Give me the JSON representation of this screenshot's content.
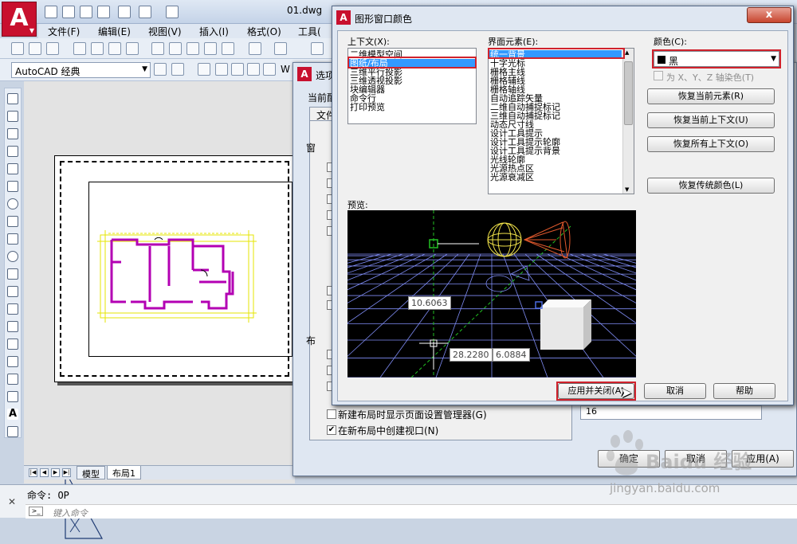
{
  "app": {
    "doc_title": "01.dwg",
    "logo_letter": "A",
    "menus": [
      "文件(F)",
      "编辑(E)",
      "视图(V)",
      "插入(I)",
      "格式(O)",
      "工具("
    ],
    "workspace": "AutoCAD 经典",
    "toolbar2_trailing": "W"
  },
  "layout_tabs": [
    "模型",
    "布局1"
  ],
  "command": {
    "history": "命令: OP",
    "placeholder": "键入命令",
    "prompt_icon": ">_"
  },
  "options_dialog": {
    "title": "选项",
    "current_profile_label": "当前配",
    "tab_label": "文件",
    "group1_label": "窗",
    "group2_label": "布",
    "checkbox1_label": "新建布局时显示页面设置管理器(G)",
    "checkbox2_label": "在新布局中创建视口(N)",
    "checkbox2_checked": true,
    "right_field": "16",
    "buttons": [
      "确定",
      "取消",
      "应用(A)"
    ]
  },
  "color_dialog": {
    "title": "图形窗口颜色",
    "close_glyph": "x",
    "context_label": "上下文(X):",
    "context_items": [
      "二维模型空间",
      "图纸/布局",
      "三维平行投影",
      "三维透视投影",
      "块编辑器",
      "命令行",
      "打印预览"
    ],
    "context_selected_index": 1,
    "element_label": "界面元素(E):",
    "element_items": [
      "统一背景",
      "十字光标",
      "栅格主线",
      "栅格辅线",
      "栅格轴线",
      "自动追踪矢量",
      "二维自动捕捉标记",
      "三维自动捕捉标记",
      "动态尺寸线",
      "设计工具提示",
      "设计工具提示轮廓",
      "设计工具提示背景",
      "光线轮廓",
      "光源热点区",
      "光源衰减区"
    ],
    "element_selected_index": 0,
    "color_label": "颜色(C):",
    "color_value": "黑",
    "color_swatch_hex": "#000000",
    "tint_label": "为 X、Y、Z 轴染色(T)",
    "buttons": {
      "restore_current_element": "恢复当前元素(R)",
      "restore_current_context": "恢复当前上下文(U)",
      "restore_all_contexts": "恢复所有上下文(O)",
      "restore_classic_colors": "恢复传统颜色(L)",
      "apply_close": "应用并关闭(A)",
      "cancel": "取消",
      "help": "帮助"
    },
    "preview_label": "预览:",
    "preview": {
      "dim_value": "10.6063",
      "coord_x": "28.2280",
      "coord_y": "6.0884",
      "background_hex": "#000000",
      "grid_hex": "#7f8cf5",
      "accent_green": "#22c022",
      "sphere_hex": "#f2e34a",
      "cone_hex": "#e0582c"
    }
  },
  "watermark": {
    "brand": "Baidu 经验",
    "url": "jingyan.baidu.com"
  },
  "colors": {
    "highlight_red": "#d0222c",
    "selection_blue": "#3399ff",
    "cad_red": "#c8102e",
    "plan_magenta": "#b300b3",
    "plan_yellow": "#e6e600"
  }
}
